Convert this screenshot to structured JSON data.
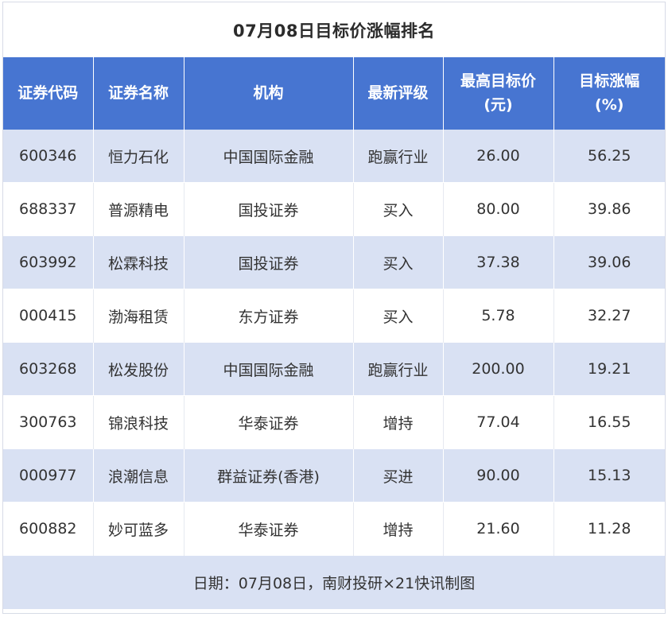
{
  "title": "07月08日目标价涨幅排名",
  "header": {
    "columns": [
      {
        "line1": "证券代码",
        "line2": ""
      },
      {
        "line1": "证券名称",
        "line2": ""
      },
      {
        "line1": "机构",
        "line2": ""
      },
      {
        "line1": "最新评级",
        "line2": ""
      },
      {
        "line1": "最高目标价",
        "line2": "(元)"
      },
      {
        "line1": "目标涨幅",
        "line2": "(%)"
      }
    ]
  },
  "rows": [
    {
      "code": "600346",
      "name": "恒力石化",
      "org": "中国国际金融",
      "rating": "跑赢行业",
      "price": "26.00",
      "upside": "56.25"
    },
    {
      "code": "688337",
      "name": "普源精电",
      "org": "国投证券",
      "rating": "买入",
      "price": "80.00",
      "upside": "39.86"
    },
    {
      "code": "603992",
      "name": "松霖科技",
      "org": "国投证券",
      "rating": "买入",
      "price": "37.38",
      "upside": "39.06"
    },
    {
      "code": "000415",
      "name": "渤海租赁",
      "org": "东方证券",
      "rating": "买入",
      "price": "5.78",
      "upside": "32.27"
    },
    {
      "code": "603268",
      "name": "松发股份",
      "org": "中国国际金融",
      "rating": "跑赢行业",
      "price": "200.00",
      "upside": "19.21"
    },
    {
      "code": "300763",
      "name": "锦浪科技",
      "org": "华泰证券",
      "rating": "增持",
      "price": "77.04",
      "upside": "16.55"
    },
    {
      "code": "000977",
      "name": "浪潮信息",
      "org": "群益证券(香港)",
      "rating": "买进",
      "price": "90.00",
      "upside": "15.13"
    },
    {
      "code": "600882",
      "name": "妙可蓝多",
      "org": "华泰证券",
      "rating": "增持",
      "price": "21.60",
      "upside": "11.28"
    }
  ],
  "footer": "日期：07月08日，南财投研×21快讯制图",
  "colors": {
    "header_bg": "#4775d1",
    "stripe_bg": "#d9e1f3"
  }
}
